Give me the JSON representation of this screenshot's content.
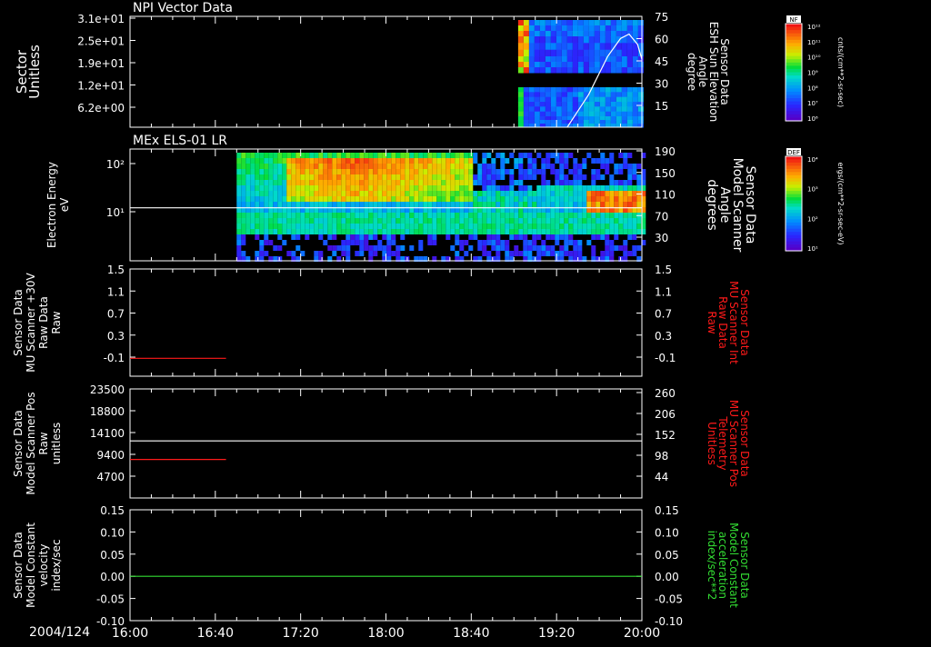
{
  "colors": {
    "background": "#000000",
    "axis": "#ffffff",
    "red": "#ff1a1a",
    "green": "#33dd33"
  },
  "footer": {
    "date_label": "2004/124"
  },
  "x_axis": {
    "range": [
      "16:00",
      "20:00"
    ],
    "ticks": [
      "16:00",
      "16:40",
      "17:20",
      "18:00",
      "18:40",
      "19:20",
      "20:00"
    ]
  },
  "chart_data": [
    {
      "id": "panel1",
      "type": "heatmap",
      "title": "NPI Vector Data",
      "ylabel": [
        "Sector",
        "Unitless"
      ],
      "yticks": [
        "3.1e+01",
        "2.5e+01",
        "1.9e+01",
        "1.2e+01",
        "6.2e+00"
      ],
      "ylim": [
        0,
        32
      ],
      "y2label": [
        "Sensor Data",
        "ESH Sun Elevation",
        "Angle",
        "degree"
      ],
      "y2ticks": [
        "75",
        "60",
        "45",
        "30",
        "15"
      ],
      "y2lim": [
        0,
        75
      ],
      "data_start": "19:02",
      "data_end": "20:00",
      "overlay_line": {
        "color": "#ffffff",
        "points": [
          [
            "19:25",
            0
          ],
          [
            "19:35",
            22
          ],
          [
            "19:44",
            48
          ],
          [
            "19:50",
            60
          ],
          [
            "19:54",
            63
          ],
          [
            "19:58",
            56
          ],
          [
            "20:00",
            46
          ]
        ]
      },
      "colorbar": {
        "label": "cnts/(cm**2-sr-sec)",
        "tag": "NF",
        "ticks": [
          "10¹²",
          "10¹¹",
          "10¹⁰",
          "10⁹",
          "10⁸",
          "10⁷",
          "10⁶"
        ]
      }
    },
    {
      "id": "panel2",
      "type": "heatmap",
      "title": "MEx ELS-01 LR",
      "ylabel": [
        "Electron Energy",
        "eV"
      ],
      "yticks": [
        "10²",
        "10¹"
      ],
      "ylim": [
        1,
        300
      ],
      "y2label": [
        "Sensor Data",
        "Model Scanner",
        "Angle",
        "degrees"
      ],
      "y2ticks": [
        "190",
        "150",
        "110",
        "70",
        "30"
      ],
      "y2lim": [
        0,
        190
      ],
      "data_start": "16:50",
      "data_end": "20:00",
      "overlay_line": {
        "color": "#ffffff",
        "points": [
          [
            "16:00",
            90
          ],
          [
            "20:00",
            90
          ]
        ]
      },
      "colorbar": {
        "label": "ergs/(cm**2-sr-sec-eV)",
        "tag": "DEF",
        "ticks": [
          "10⁴",
          "10³",
          "10²",
          "10¹"
        ]
      }
    },
    {
      "id": "panel3",
      "type": "line",
      "ylabel": [
        "Sensor Data",
        "MU Scanner +30V",
        "Raw Data",
        "Raw"
      ],
      "yticks": [
        "1.5",
        "1.1",
        "0.7",
        "0.3",
        "-0.1"
      ],
      "ylim": [
        -0.3,
        1.5
      ],
      "y2label": [
        "Sensor Data",
        "MU Scanner Int",
        "Raw Data",
        "Raw"
      ],
      "y2ticks": [
        "1.5",
        "1.1",
        "0.7",
        "0.3",
        "-0.1"
      ],
      "y2lim": [
        -0.3,
        1.5
      ],
      "series": [
        {
          "color": "#ff1a1a",
          "points": [
            [
              "16:00",
              0.0
            ],
            [
              "16:45",
              0.0
            ]
          ]
        }
      ]
    },
    {
      "id": "panel4",
      "type": "line",
      "ylabel": [
        "Sensor Data",
        "Model Scanner Pos",
        "Raw",
        "unitless"
      ],
      "yticks": [
        "23500",
        "18800",
        "14100",
        "9400",
        "4700"
      ],
      "ylim": [
        0,
        23500
      ],
      "y2label": [
        "Sensor Data",
        "MU Scanner Pos",
        "Telemetry",
        "Unitless"
      ],
      "y2ticks": [
        "260",
        "206",
        "152",
        "98",
        "44"
      ],
      "y2lim": [
        0,
        260
      ],
      "series": [
        {
          "color": "#ff1a1a",
          "points": [
            [
              "16:00",
              8300
            ],
            [
              "16:45",
              8300
            ]
          ]
        },
        {
          "color": "#ffffff",
          "points": [
            [
              "16:00",
              12300
            ],
            [
              "20:00",
              12300
            ]
          ]
        }
      ]
    },
    {
      "id": "panel5",
      "type": "line",
      "ylabel": [
        "Sensor Data",
        "Model Constant",
        "velocity",
        "index/sec"
      ],
      "yticks": [
        "0.15",
        "0.10",
        "0.05",
        "0.00",
        "-0.05",
        "-0.10"
      ],
      "ylim": [
        -0.1,
        0.15
      ],
      "y2label": [
        "Sensor Data",
        "Model Constant",
        "acceleration",
        "index/sec**2"
      ],
      "y2ticks": [
        "0.15",
        "0.10",
        "0.05",
        "0.00",
        "-0.05",
        "-0.10"
      ],
      "y2lim": [
        -0.1,
        0.15
      ],
      "series": [
        {
          "color": "#33dd33",
          "points": [
            [
              "16:00",
              0.0
            ],
            [
              "20:00",
              0.0
            ]
          ]
        }
      ]
    }
  ]
}
